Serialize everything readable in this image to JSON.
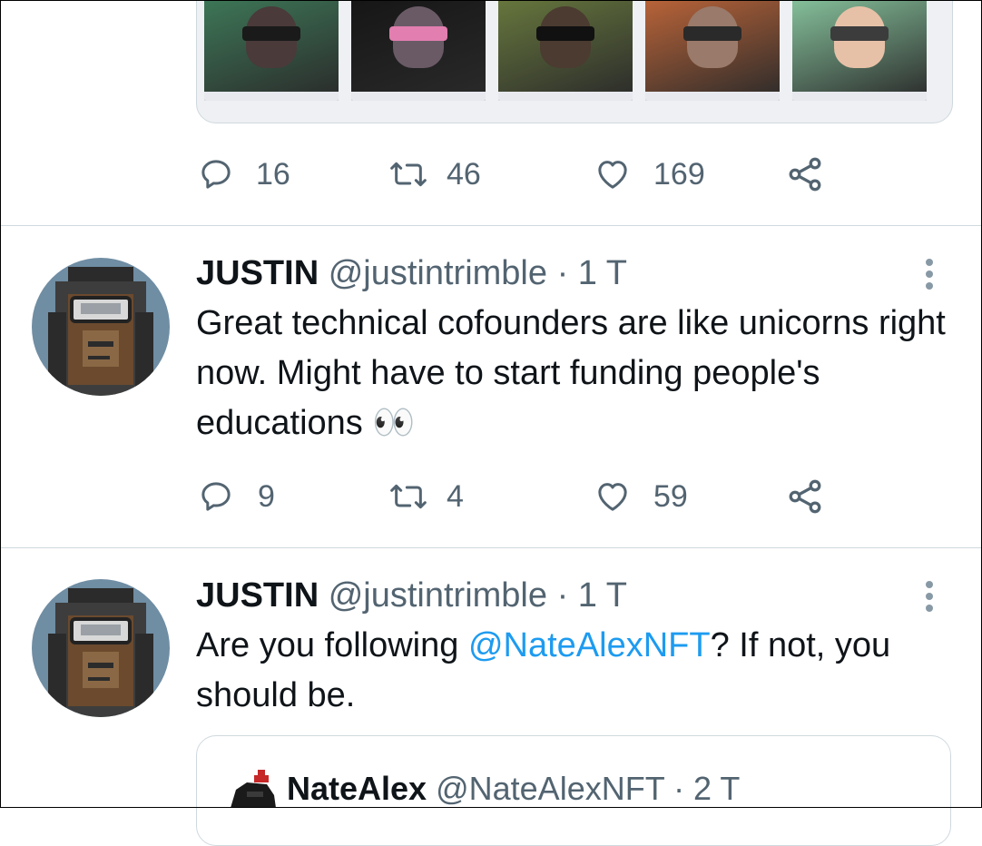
{
  "top_post": {
    "media_thumbnails": [
      {
        "bg": "#3f7f5c",
        "face": "#4a3a3a",
        "visor": "#1a1a1a"
      },
      {
        "bg": "#141414",
        "face": "#6a5a66",
        "visor": "#e27eb0"
      },
      {
        "bg": "#6d7f3f",
        "face": "#4b3b30",
        "visor": "#111111"
      },
      {
        "bg": "#c96a3a",
        "face": "#9a7a6a",
        "visor": "#2a2a2a"
      },
      {
        "bg": "#8fd1a7",
        "face": "#e7c1a7",
        "visor": "#3c3c3c"
      }
    ],
    "actions": {
      "replies": "16",
      "retweets": "46",
      "likes": "169"
    }
  },
  "tweets": [
    {
      "display_name": "JUSTIN",
      "handle": "@justintrimble",
      "time": "· 1 T",
      "text": "Great technical cofounders are like unicorns right now. Might have to start funding people's educations",
      "emoji": "👀",
      "actions": {
        "replies": "9",
        "retweets": "4",
        "likes": "59"
      }
    },
    {
      "display_name": "JUSTIN",
      "handle": "@justintrimble",
      "time": "· 1 T",
      "text_before": "Are you following ",
      "mention": "@NateAlexNFT",
      "text_after": "? If not, you should be.",
      "quoted": {
        "display_name": "NateAlex",
        "handle": "@NateAlexNFT",
        "time": "· 2 T"
      }
    }
  ],
  "icons": {
    "reply": "reply-icon",
    "retweet": "retweet-icon",
    "like": "heart-icon",
    "share": "share-icon",
    "more": "more-vertical-icon"
  },
  "colors": {
    "icon_gray": "#536471",
    "link_blue": "#1d9bf0",
    "divider": "#cfd9de"
  }
}
